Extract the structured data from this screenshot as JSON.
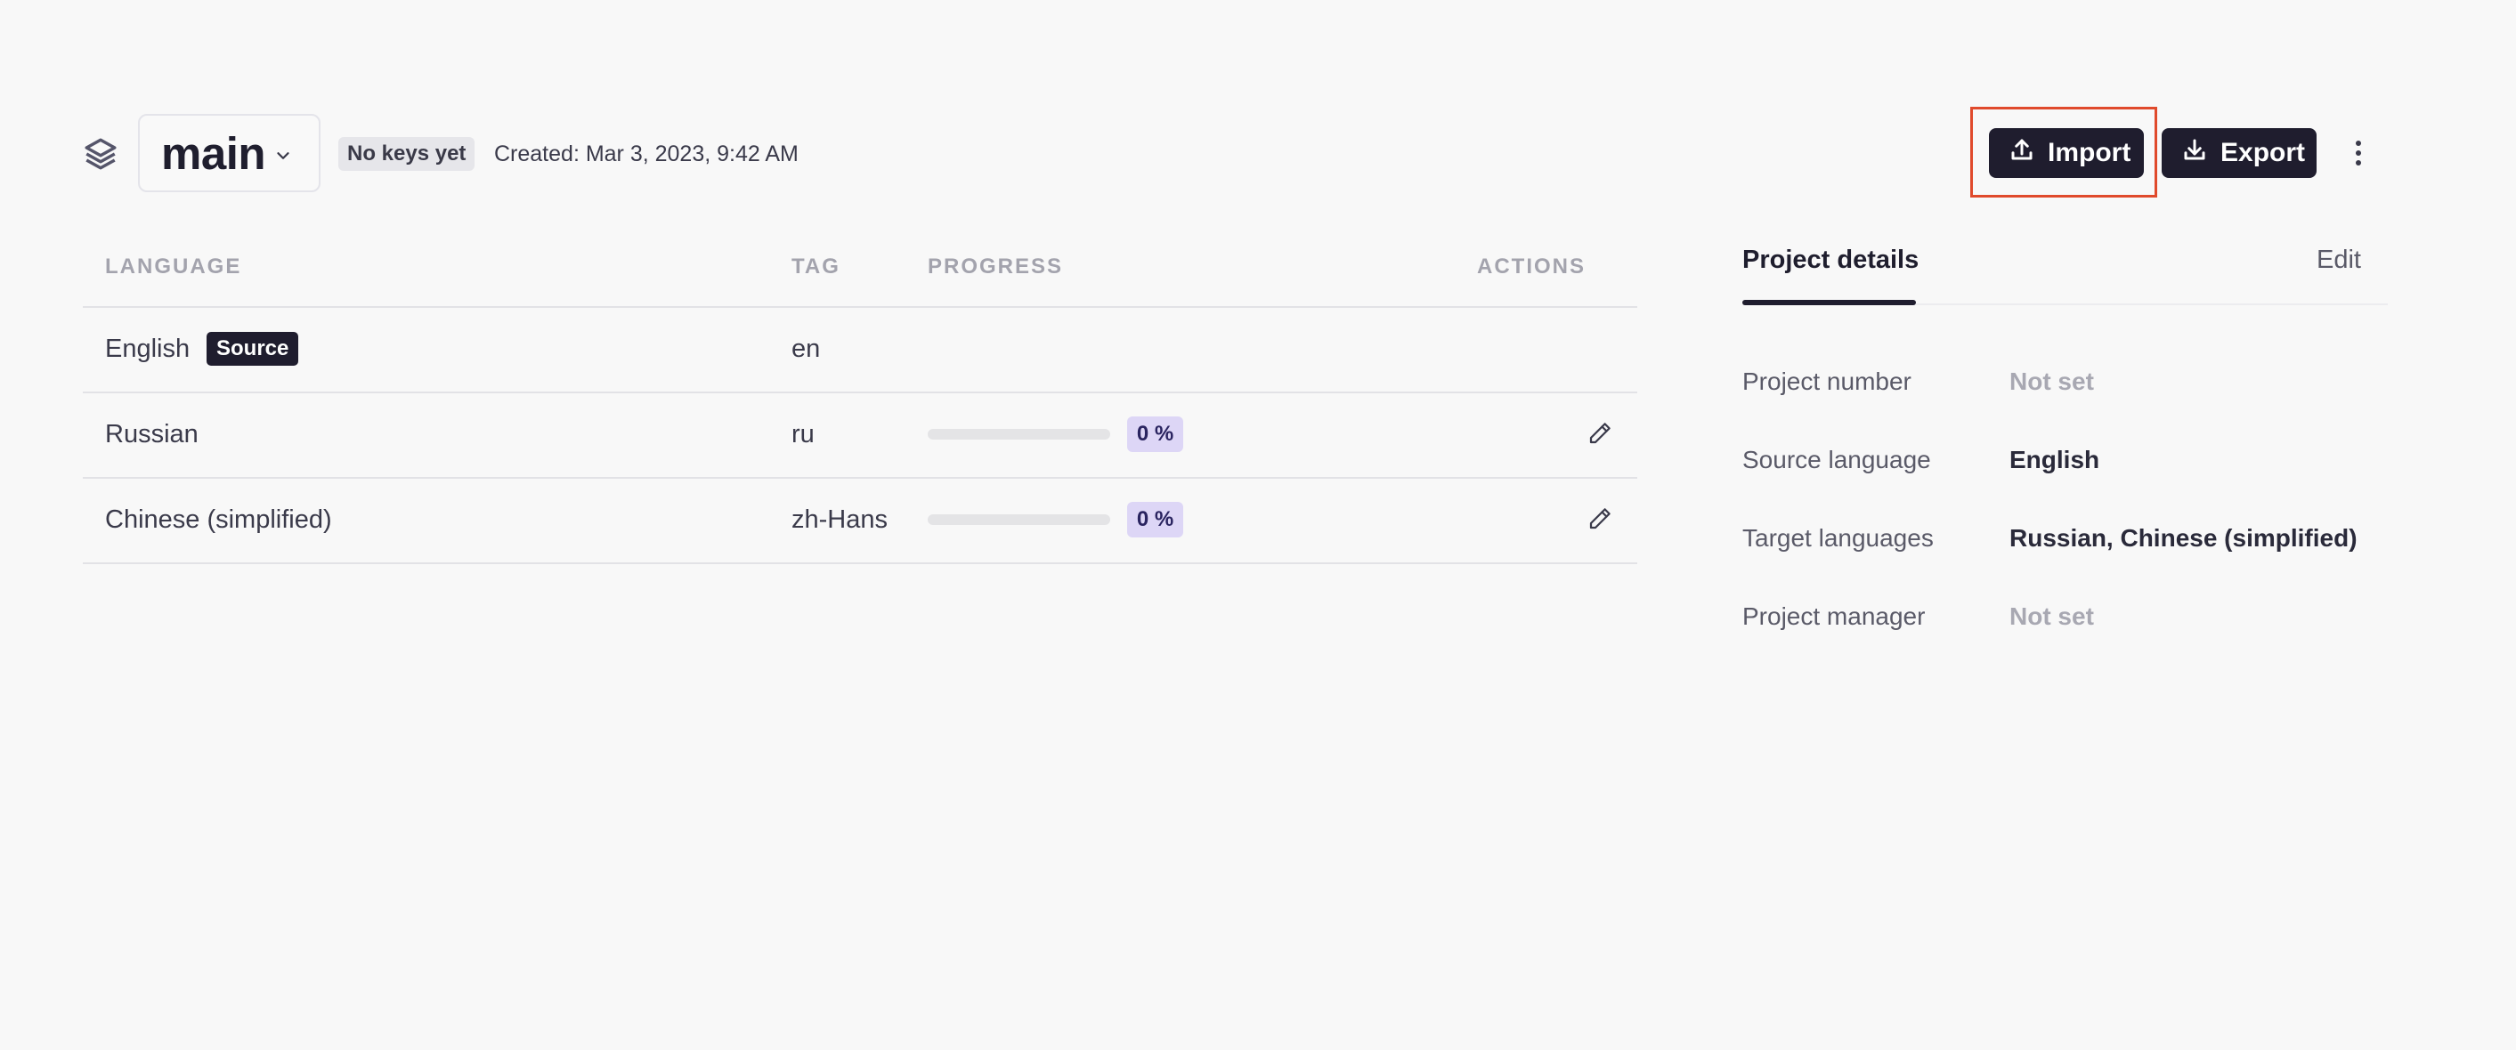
{
  "header": {
    "branch": "main",
    "keys_badge": "No keys yet",
    "created": "Created: Mar 3, 2023, 9:42 AM",
    "import_label": "Import",
    "export_label": "Export"
  },
  "table": {
    "columns": [
      "LANGUAGE",
      "TAG",
      "PROGRESS",
      "ACTIONS"
    ],
    "source_badge": "Source",
    "rows": [
      {
        "language": "English",
        "tag": "en",
        "is_source": true
      },
      {
        "language": "Russian",
        "tag": "ru",
        "progress": 0,
        "progress_label": "0 %"
      },
      {
        "language": "Chinese (simplified)",
        "tag": "zh-Hans",
        "progress": 0,
        "progress_label": "0 %"
      }
    ]
  },
  "details": {
    "tab_label": "Project details",
    "edit_label": "Edit",
    "fields": [
      {
        "label": "Project number",
        "value": "Not set",
        "muted": true
      },
      {
        "label": "Source language",
        "value": "English",
        "muted": false
      },
      {
        "label": "Target languages",
        "value": "Russian, Chinese (simplified)",
        "muted": false
      },
      {
        "label": "Project manager",
        "value": "Not set",
        "muted": true
      }
    ]
  },
  "icons": [
    "layers-icon",
    "chevron-down-icon",
    "upload-icon",
    "download-icon",
    "more-vertical-icon",
    "pencil-icon"
  ],
  "colors": {
    "primary": "#1f1d2e",
    "highlight": "#e04a2c",
    "progress_badge": "#ddd6f6",
    "progress_fill": "#7b6ad8"
  }
}
